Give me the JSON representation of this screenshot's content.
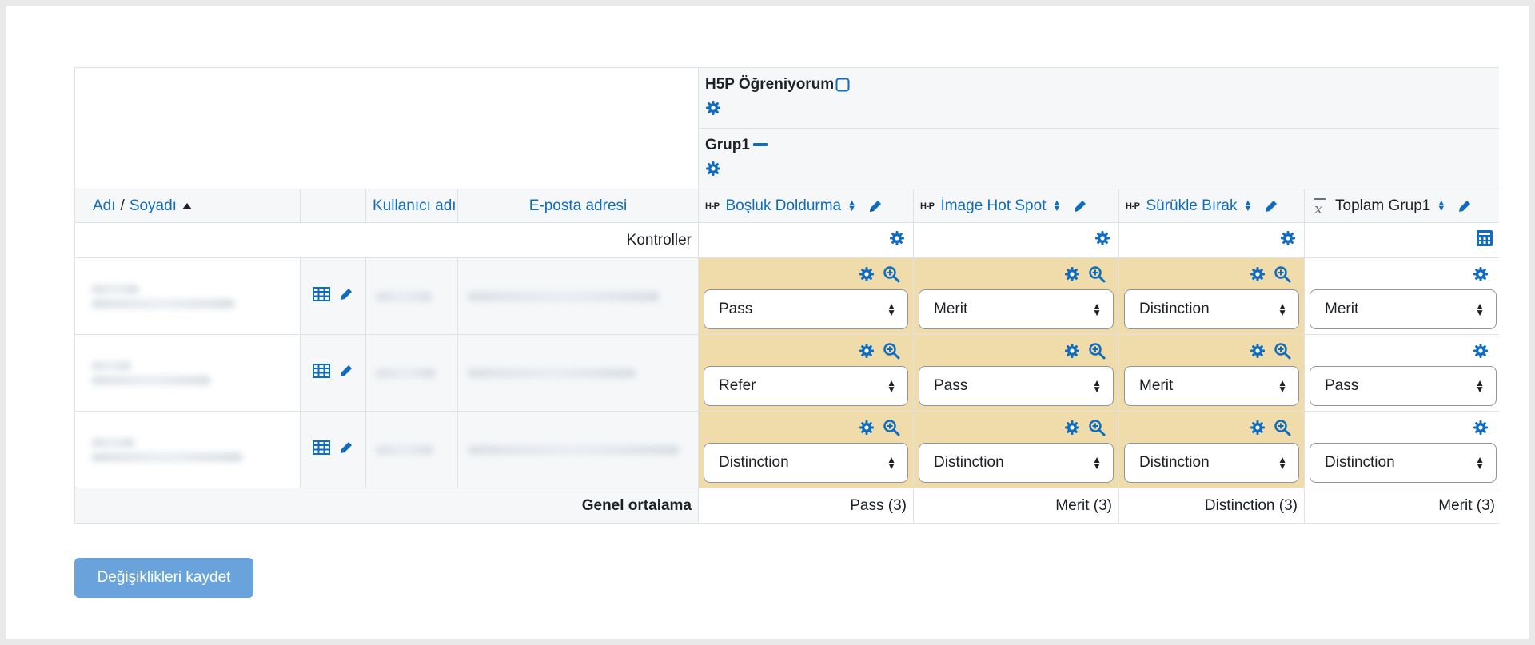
{
  "category": {
    "title": "H5P Öğreniyorum",
    "group": "Grup1"
  },
  "columns": {
    "first_name": "Adı",
    "separator": "/",
    "last_name": "Soyadı",
    "username": "Kullanıcı adı",
    "email": "E-posta adresi",
    "h5p_badge": "H-P",
    "items": [
      {
        "label": "Boşluk Doldurma"
      },
      {
        "label": "İmage Hot Spot"
      },
      {
        "label": "Sürükle Bırak"
      },
      {
        "label": "Toplam Grup1"
      }
    ]
  },
  "controls_label": "Kontroller",
  "rows": [
    {
      "grades": [
        "Pass",
        "Merit",
        "Distinction",
        "Merit"
      ]
    },
    {
      "grades": [
        "Refer",
        "Pass",
        "Merit",
        "Pass"
      ]
    },
    {
      "grades": [
        "Distinction",
        "Distinction",
        "Distinction",
        "Distinction"
      ]
    }
  ],
  "average": {
    "label": "Genel ortalama",
    "values": [
      "Pass (3)",
      "Merit (3)",
      "Distinction (3)",
      "Merit (3)"
    ]
  },
  "save_button": "Değişiklikleri kaydet",
  "colors": {
    "link": "#0f6cbf",
    "grade_bg": "#f0dcaa",
    "button": "#6aa3db"
  }
}
